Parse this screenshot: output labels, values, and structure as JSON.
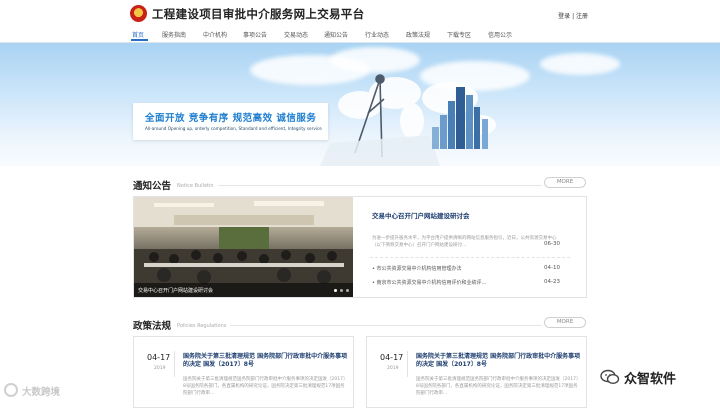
{
  "header": {
    "site_title": "工程建设项目审批中介服务网上交易平台",
    "login_links": "登录 | 注册"
  },
  "nav": {
    "items": [
      {
        "label": "首页",
        "active": true
      },
      {
        "label": "服务指南",
        "active": false
      },
      {
        "label": "中介机构",
        "active": false
      },
      {
        "label": "事项公告",
        "active": false
      },
      {
        "label": "交易动态",
        "active": false
      },
      {
        "label": "通知公告",
        "active": false
      },
      {
        "label": "行业动态",
        "active": false
      },
      {
        "label": "政策法规",
        "active": false
      },
      {
        "label": "下载专区",
        "active": false
      },
      {
        "label": "信用公示",
        "active": false
      }
    ]
  },
  "banner": {
    "slogan": "全面开放  竞争有序  规范高效  诚信服务",
    "slogan_sub": "All-around Opening up, orderly competition, Standard and efficient, Integrity service"
  },
  "notice": {
    "title": "通知公告",
    "subtitle": "Notice Bulletin",
    "more": "MORE",
    "photo_caption": "交易中心召开门户网站建设研讨会",
    "featured": {
      "title": "交易中心召开门户网站建设研讨会",
      "desc": "为进一步提升服务水平，为平台用户提供清晰的网站信息服务指引，近日，公共资源交易中心（以下简称交易中心）召开门户网站建设研讨…",
      "date": "06-30"
    },
    "items": [
      {
        "label": "• 市公共资源交易中介机构信用管理办法",
        "date": "04-10"
      },
      {
        "label": "• 南京市公共资源交易中介机构信用评价和业绩评…",
        "date": "04-23"
      }
    ]
  },
  "policy": {
    "title": "政策法规",
    "subtitle": "Policies Regulations",
    "more": "MORE",
    "cards": [
      {
        "date": "04-17",
        "year": "2019",
        "title": "国务院关于第三批清理规范 国务院部门行政审批中介服务事项的决定 国发〔2017〕8号",
        "body": "国务院关于第三批清理规范国务院部门行政审批中介服务事项的决定国发〔2017〕8号国务院各部门，各直属机构的研究论证，国务院决定第三批清理规范17项国务院部门行政审…"
      },
      {
        "date": "04-17",
        "year": "2019",
        "title": "国务院关于第三批清理规范 国务院部门行政审批中介服务事项的决定 国发〔2017〕8号",
        "body": "国务院关于第三批清理规范国务院部门行政审批中介服务事项的决定国发〔2017〕8号国务院各部门，各直属机构的研究论证，国务院决定第三批清理规范17项国务院部门行政审…"
      }
    ]
  },
  "watermarks": {
    "left": "大数跨境",
    "right": "众智软件"
  }
}
